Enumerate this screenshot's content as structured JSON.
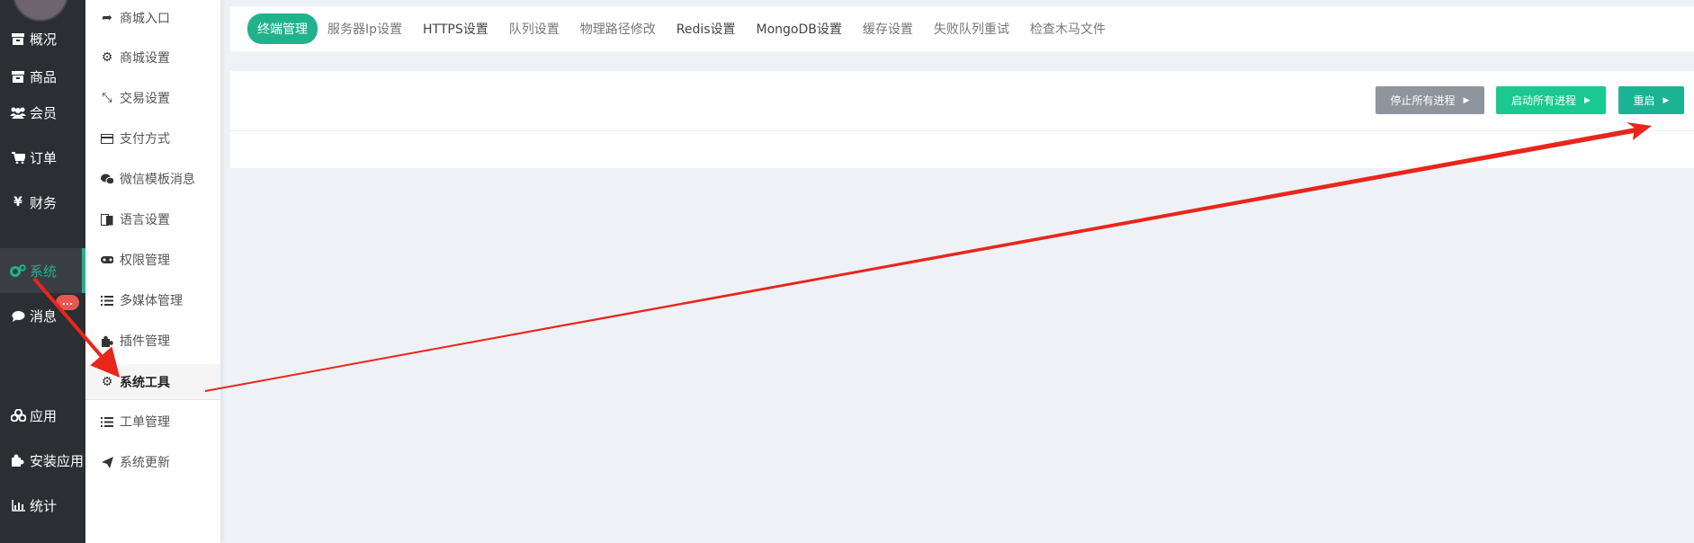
{
  "sidebar": {
    "items": [
      {
        "label": "概况",
        "icon": "archive-icon"
      },
      {
        "label": "商品",
        "icon": "archive-icon"
      },
      {
        "label": "会员",
        "icon": "users-icon"
      },
      {
        "label": "订单",
        "icon": "cart-icon"
      },
      {
        "label": "财务",
        "icon": "yen-icon"
      },
      {
        "label": "系统",
        "icon": "cogs-icon",
        "active": true
      },
      {
        "label": "消息",
        "icon": "chat-icon",
        "badge": "..."
      },
      {
        "label": "应用",
        "icon": "cubes-icon"
      },
      {
        "label": "安装应用",
        "icon": "puzzle-icon"
      },
      {
        "label": "统计",
        "icon": "bar-chart-icon"
      }
    ]
  },
  "submenu": {
    "items": [
      {
        "label": "商城入口",
        "icon": "share-icon"
      },
      {
        "label": "商城设置",
        "icon": "gear-icon"
      },
      {
        "label": "交易设置",
        "icon": "compress-icon"
      },
      {
        "label": "支付方式",
        "icon": "credit-card-icon"
      },
      {
        "label": "微信模板消息",
        "icon": "wechat-icon"
      },
      {
        "label": "语言设置",
        "icon": "language-icon"
      },
      {
        "label": "权限管理",
        "icon": "gamepad-icon"
      },
      {
        "label": "多媒体管理",
        "icon": "list-icon"
      },
      {
        "label": "插件管理",
        "icon": "puzzle-icon"
      },
      {
        "label": "系统工具",
        "icon": "gear-icon",
        "active": true
      },
      {
        "label": "工单管理",
        "icon": "list-icon"
      },
      {
        "label": "系统更新",
        "icon": "send-icon"
      }
    ]
  },
  "tabs": [
    {
      "label": "终端管理",
      "active": true
    },
    {
      "label": "服务器Ip设置"
    },
    {
      "label": "HTTPS设置"
    },
    {
      "label": "队列设置"
    },
    {
      "label": "物理路径修改"
    },
    {
      "label": "Redis设置"
    },
    {
      "label": "MongoDB设置"
    },
    {
      "label": "缓存设置"
    },
    {
      "label": "失败队列重试"
    },
    {
      "label": "检查木马文件"
    }
  ],
  "actions": {
    "stop_all": "停止所有进程",
    "start_all": "启动所有进程",
    "restart": "重启"
  },
  "colors": {
    "accent": "#20b28c",
    "sidebar_bg": "#2b2e33",
    "btn_gray": "#8f959c",
    "btn_green": "#1ac98f",
    "btn_teal": "#1cb394",
    "badge": "#e9554f",
    "annotation_arrow": "#e8261c"
  }
}
